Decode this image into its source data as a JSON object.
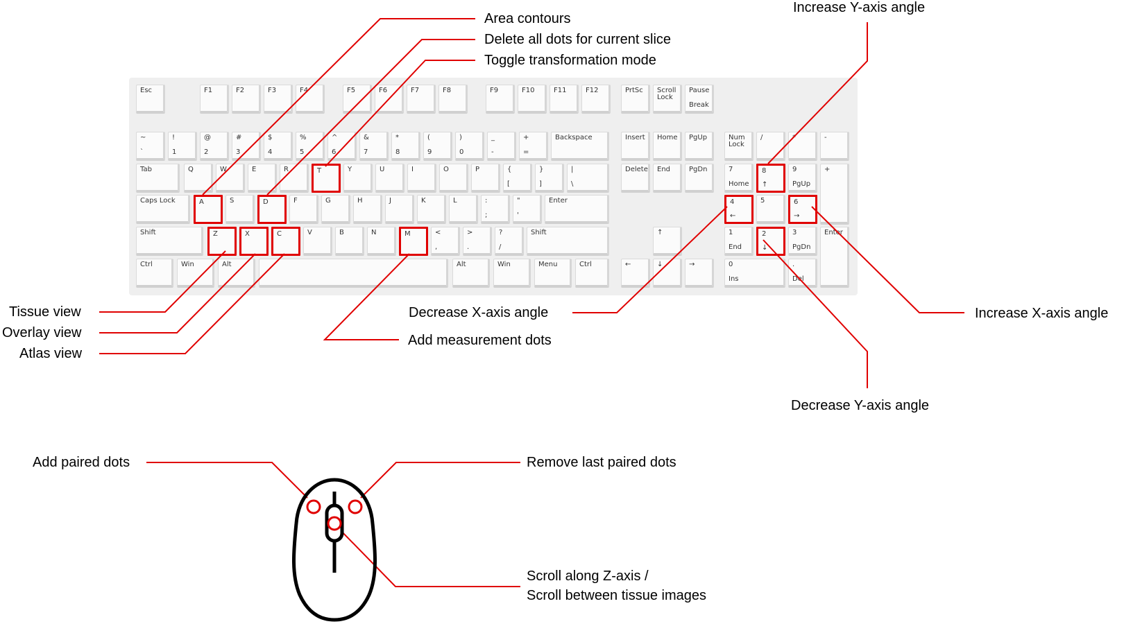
{
  "keyboard": {
    "keys": [
      {
        "id": "esc",
        "top": "Esc",
        "bottom": "",
        "highlighted": false
      },
      {
        "id": "f1",
        "top": "F1",
        "bottom": "",
        "highlighted": false
      },
      {
        "id": "f2",
        "top": "F2",
        "bottom": "",
        "highlighted": false
      },
      {
        "id": "f3",
        "top": "F3",
        "bottom": "",
        "highlighted": false
      },
      {
        "id": "f4",
        "top": "F4",
        "bottom": "",
        "highlighted": false
      },
      {
        "id": "f5",
        "top": "F5",
        "bottom": "",
        "highlighted": false
      },
      {
        "id": "f6",
        "top": "F6",
        "bottom": "",
        "highlighted": false
      },
      {
        "id": "f7",
        "top": "F7",
        "bottom": "",
        "highlighted": false
      },
      {
        "id": "f8",
        "top": "F8",
        "bottom": "",
        "highlighted": false
      },
      {
        "id": "f9",
        "top": "F9",
        "bottom": "",
        "highlighted": false
      },
      {
        "id": "f10",
        "top": "F10",
        "bottom": "",
        "highlighted": false
      },
      {
        "id": "f11",
        "top": "F11",
        "bottom": "",
        "highlighted": false
      },
      {
        "id": "f12",
        "top": "F12",
        "bottom": "",
        "highlighted": false
      },
      {
        "id": "prtsc",
        "top": "PrtSc",
        "bottom": "",
        "highlighted": false
      },
      {
        "id": "scrolllock",
        "top": "Scroll\nLock",
        "bottom": "",
        "highlighted": false
      },
      {
        "id": "pause",
        "top": "Pause",
        "bottom": "Break",
        "highlighted": false
      },
      {
        "id": "tilde",
        "top": "~",
        "bottom": "`",
        "highlighted": false
      },
      {
        "id": "1",
        "top": "!",
        "bottom": "1",
        "highlighted": false
      },
      {
        "id": "2",
        "top": "@",
        "bottom": "2",
        "highlighted": false
      },
      {
        "id": "3",
        "top": "#",
        "bottom": "3",
        "highlighted": false
      },
      {
        "id": "4",
        "top": "$",
        "bottom": "4",
        "highlighted": false
      },
      {
        "id": "5",
        "top": "%",
        "bottom": "5",
        "highlighted": false
      },
      {
        "id": "6",
        "top": "^",
        "bottom": "6",
        "highlighted": false
      },
      {
        "id": "7",
        "top": "&",
        "bottom": "7",
        "highlighted": false
      },
      {
        "id": "8",
        "top": "*",
        "bottom": "8",
        "highlighted": false
      },
      {
        "id": "9",
        "top": "(",
        "bottom": "9",
        "highlighted": false
      },
      {
        "id": "0",
        "top": ")",
        "bottom": "0",
        "highlighted": false
      },
      {
        "id": "minus",
        "top": "_",
        "bottom": "-",
        "highlighted": false
      },
      {
        "id": "equal",
        "top": "+",
        "bottom": "=",
        "highlighted": false
      },
      {
        "id": "backspace",
        "top": "Backspace",
        "bottom": "",
        "highlighted": false
      },
      {
        "id": "insert",
        "top": "Insert",
        "bottom": "",
        "highlighted": false
      },
      {
        "id": "home",
        "top": "Home",
        "bottom": "",
        "highlighted": false
      },
      {
        "id": "pgup",
        "top": "PgUp",
        "bottom": "",
        "highlighted": false
      },
      {
        "id": "numlock",
        "top": "Num\nLock",
        "bottom": "",
        "highlighted": false
      },
      {
        "id": "numslash",
        "top": "/",
        "bottom": "",
        "highlighted": false
      },
      {
        "id": "numstar",
        "top": "*",
        "bottom": "",
        "highlighted": false
      },
      {
        "id": "numminus",
        "top": "-",
        "bottom": "",
        "highlighted": false
      },
      {
        "id": "tab",
        "top": "Tab",
        "bottom": "",
        "highlighted": false
      },
      {
        "id": "q",
        "top": "Q",
        "bottom": "",
        "highlighted": false
      },
      {
        "id": "w",
        "top": "W",
        "bottom": "",
        "highlighted": false
      },
      {
        "id": "e",
        "top": "E",
        "bottom": "",
        "highlighted": false
      },
      {
        "id": "r",
        "top": "R",
        "bottom": "",
        "highlighted": false
      },
      {
        "id": "t",
        "top": "T",
        "bottom": "",
        "highlighted": true
      },
      {
        "id": "y",
        "top": "Y",
        "bottom": "",
        "highlighted": false
      },
      {
        "id": "u",
        "top": "U",
        "bottom": "",
        "highlighted": false
      },
      {
        "id": "i",
        "top": "I",
        "bottom": "",
        "highlighted": false
      },
      {
        "id": "o",
        "top": "O",
        "bottom": "",
        "highlighted": false
      },
      {
        "id": "p",
        "top": "P",
        "bottom": "",
        "highlighted": false
      },
      {
        "id": "lbracket",
        "top": "{",
        "bottom": "[",
        "highlighted": false
      },
      {
        "id": "rbracket",
        "top": "}",
        "bottom": "]",
        "highlighted": false
      },
      {
        "id": "backslash",
        "top": "|",
        "bottom": "\\",
        "highlighted": false
      },
      {
        "id": "delete",
        "top": "Delete",
        "bottom": "",
        "highlighted": false
      },
      {
        "id": "end",
        "top": "End",
        "bottom": "",
        "highlighted": false
      },
      {
        "id": "pgdn",
        "top": "PgDn",
        "bottom": "",
        "highlighted": false
      },
      {
        "id": "num7",
        "top": "7",
        "bottom": "Home",
        "highlighted": false
      },
      {
        "id": "num8",
        "top": "8",
        "bottom": "↑",
        "highlighted": true
      },
      {
        "id": "num9",
        "top": "9",
        "bottom": "PgUp",
        "highlighted": false
      },
      {
        "id": "numplus",
        "top": "+",
        "bottom": "",
        "highlighted": false
      },
      {
        "id": "capslock",
        "top": "Caps Lock",
        "bottom": "",
        "highlighted": false
      },
      {
        "id": "a",
        "top": "A",
        "bottom": "",
        "highlighted": true
      },
      {
        "id": "s",
        "top": "S",
        "bottom": "",
        "highlighted": false
      },
      {
        "id": "d",
        "top": "D",
        "bottom": "",
        "highlighted": true
      },
      {
        "id": "f",
        "top": "F",
        "bottom": "",
        "highlighted": false
      },
      {
        "id": "g",
        "top": "G",
        "bottom": "",
        "highlighted": false
      },
      {
        "id": "h",
        "top": "H",
        "bottom": "",
        "highlighted": false
      },
      {
        "id": "j",
        "top": "J",
        "bottom": "",
        "highlighted": false
      },
      {
        "id": "k",
        "top": "K",
        "bottom": "",
        "highlighted": false
      },
      {
        "id": "l",
        "top": "L",
        "bottom": "",
        "highlighted": false
      },
      {
        "id": "semicolon",
        "top": ":",
        "bottom": ";",
        "highlighted": false
      },
      {
        "id": "quote",
        "top": "\"",
        "bottom": "'",
        "highlighted": false
      },
      {
        "id": "enter",
        "top": "Enter",
        "bottom": "",
        "highlighted": false
      },
      {
        "id": "num4",
        "top": "4",
        "bottom": "←",
        "highlighted": true
      },
      {
        "id": "num5",
        "top": "5",
        "bottom": "",
        "highlighted": false
      },
      {
        "id": "num6",
        "top": "6",
        "bottom": "→",
        "highlighted": true
      },
      {
        "id": "lshift",
        "top": "Shift",
        "bottom": "",
        "highlighted": false
      },
      {
        "id": "z",
        "top": "Z",
        "bottom": "",
        "highlighted": true
      },
      {
        "id": "x",
        "top": "X",
        "bottom": "",
        "highlighted": true
      },
      {
        "id": "c",
        "top": "C",
        "bottom": "",
        "highlighted": true
      },
      {
        "id": "v",
        "top": "V",
        "bottom": "",
        "highlighted": false
      },
      {
        "id": "b",
        "top": "B",
        "bottom": "",
        "highlighted": false
      },
      {
        "id": "n",
        "top": "N",
        "bottom": "",
        "highlighted": false
      },
      {
        "id": "m",
        "top": "M",
        "bottom": "",
        "highlighted": true
      },
      {
        "id": "comma",
        "top": "<",
        "bottom": ",",
        "highlighted": false
      },
      {
        "id": "period",
        "top": ">",
        "bottom": ".",
        "highlighted": false
      },
      {
        "id": "slash",
        "top": "?",
        "bottom": "/",
        "highlighted": false
      },
      {
        "id": "rshift",
        "top": "Shift",
        "bottom": "",
        "highlighted": false
      },
      {
        "id": "arrowup",
        "top": "↑",
        "bottom": "",
        "highlighted": false
      },
      {
        "id": "num1",
        "top": "1",
        "bottom": "End",
        "highlighted": false
      },
      {
        "id": "num2",
        "top": "2",
        "bottom": "↓",
        "highlighted": true
      },
      {
        "id": "num3",
        "top": "3",
        "bottom": "PgDn",
        "highlighted": false
      },
      {
        "id": "numenter",
        "top": "Enter",
        "bottom": "",
        "highlighted": false
      },
      {
        "id": "lctrl",
        "top": "Ctrl",
        "bottom": "",
        "highlighted": false
      },
      {
        "id": "lwin",
        "top": "Win",
        "bottom": "",
        "highlighted": false
      },
      {
        "id": "lalt",
        "top": "Alt",
        "bottom": "",
        "highlighted": false
      },
      {
        "id": "space",
        "top": "",
        "bottom": "",
        "highlighted": false
      },
      {
        "id": "ralt",
        "top": "Alt",
        "bottom": "",
        "highlighted": false
      },
      {
        "id": "rwin",
        "top": "Win",
        "bottom": "",
        "highlighted": false
      },
      {
        "id": "menu",
        "top": "Menu",
        "bottom": "",
        "highlighted": false
      },
      {
        "id": "rctrl",
        "top": "Ctrl",
        "bottom": "",
        "highlighted": false
      },
      {
        "id": "arrowleft",
        "top": "←",
        "bottom": "",
        "highlighted": false
      },
      {
        "id": "arrowdown",
        "top": "↓",
        "bottom": "",
        "highlighted": false
      },
      {
        "id": "arrowright",
        "top": "→",
        "bottom": "",
        "highlighted": false
      },
      {
        "id": "num0",
        "top": "0",
        "bottom": "Ins",
        "highlighted": false
      },
      {
        "id": "numdot",
        "top": ".",
        "bottom": "Del",
        "highlighted": false
      }
    ]
  },
  "callouts": {
    "area_contours": "Area contours",
    "delete_all_dots": "Delete all dots for current slice",
    "toggle_transformation": "Toggle transformation mode",
    "increase_y": "Increase Y-axis angle",
    "tissue_view": "Tissue view",
    "overlay_view": "Overlay view",
    "atlas_view": "Atlas view",
    "decrease_x": "Decrease X-axis angle",
    "add_measurement": "Add measurement dots",
    "increase_x": "Increase X-axis angle",
    "decrease_y": "Decrease Y-axis angle",
    "add_paired": "Add paired dots",
    "remove_paired": "Remove last paired dots",
    "scroll_line1": "Scroll along Z-axis /",
    "scroll_line2": "Scroll between tissue images"
  },
  "colors": {
    "accent": "#e00000",
    "keyboard_bg": "#efefef",
    "key_face": "#fbfbfb"
  }
}
